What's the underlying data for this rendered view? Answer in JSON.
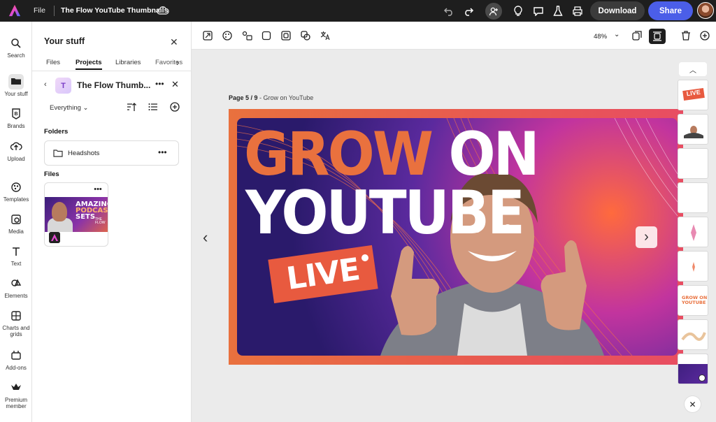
{
  "topbar": {
    "file_menu": "File",
    "document_title": "The Flow YouTube Thumbnails",
    "download_label": "Download",
    "share_label": "Share"
  },
  "rail": {
    "items": [
      {
        "label": "Search",
        "icon": "search-icon"
      },
      {
        "label": "Your stuff",
        "icon": "folder-icon"
      },
      {
        "label": "Brands",
        "icon": "brand-icon"
      },
      {
        "label": "Upload",
        "icon": "upload-icon"
      },
      {
        "label": "Templates",
        "icon": "templates-icon"
      },
      {
        "label": "Media",
        "icon": "media-icon"
      },
      {
        "label": "Text",
        "icon": "text-icon"
      },
      {
        "label": "Elements",
        "icon": "elements-icon"
      },
      {
        "label": "Charts and grids",
        "icon": "charts-icon"
      },
      {
        "label": "Add-ons",
        "icon": "addons-icon"
      },
      {
        "label": "Premium member",
        "icon": "premium-icon"
      }
    ]
  },
  "panel": {
    "title": "Your stuff",
    "tabs": [
      "Files",
      "Projects",
      "Libraries",
      "Favorites"
    ],
    "project_badge": "T",
    "project_name": "The Flow Thumb...",
    "filter": "Everything",
    "folders_heading": "Folders",
    "folder_name": "Headshots",
    "files_heading": "Files",
    "file_thumb_line1": "AMAZING",
    "file_thumb_line2": "PODCAST",
    "file_thumb_line3": "SETS",
    "file_thumb_brand1": "THE",
    "file_thumb_brand2": "FLOW"
  },
  "toolbar": {
    "zoom": "48%"
  },
  "canvas": {
    "page_label": "Page 5 / 9",
    "page_name": "Grow on YouTube",
    "headline_orange": "GROW",
    "headline_white": "ON",
    "headline_line2": "YOUTUBE",
    "live_text": "LIVE"
  },
  "pages_strip": {
    "thumb1_text": "LIVE",
    "thumb7_line1": "GROW ON",
    "thumb7_line2": "YOUTUBE"
  },
  "colors": {
    "accent": "#4b5ee8",
    "brand_orange": "#e9713e",
    "topbar": "#1e1e1e"
  }
}
